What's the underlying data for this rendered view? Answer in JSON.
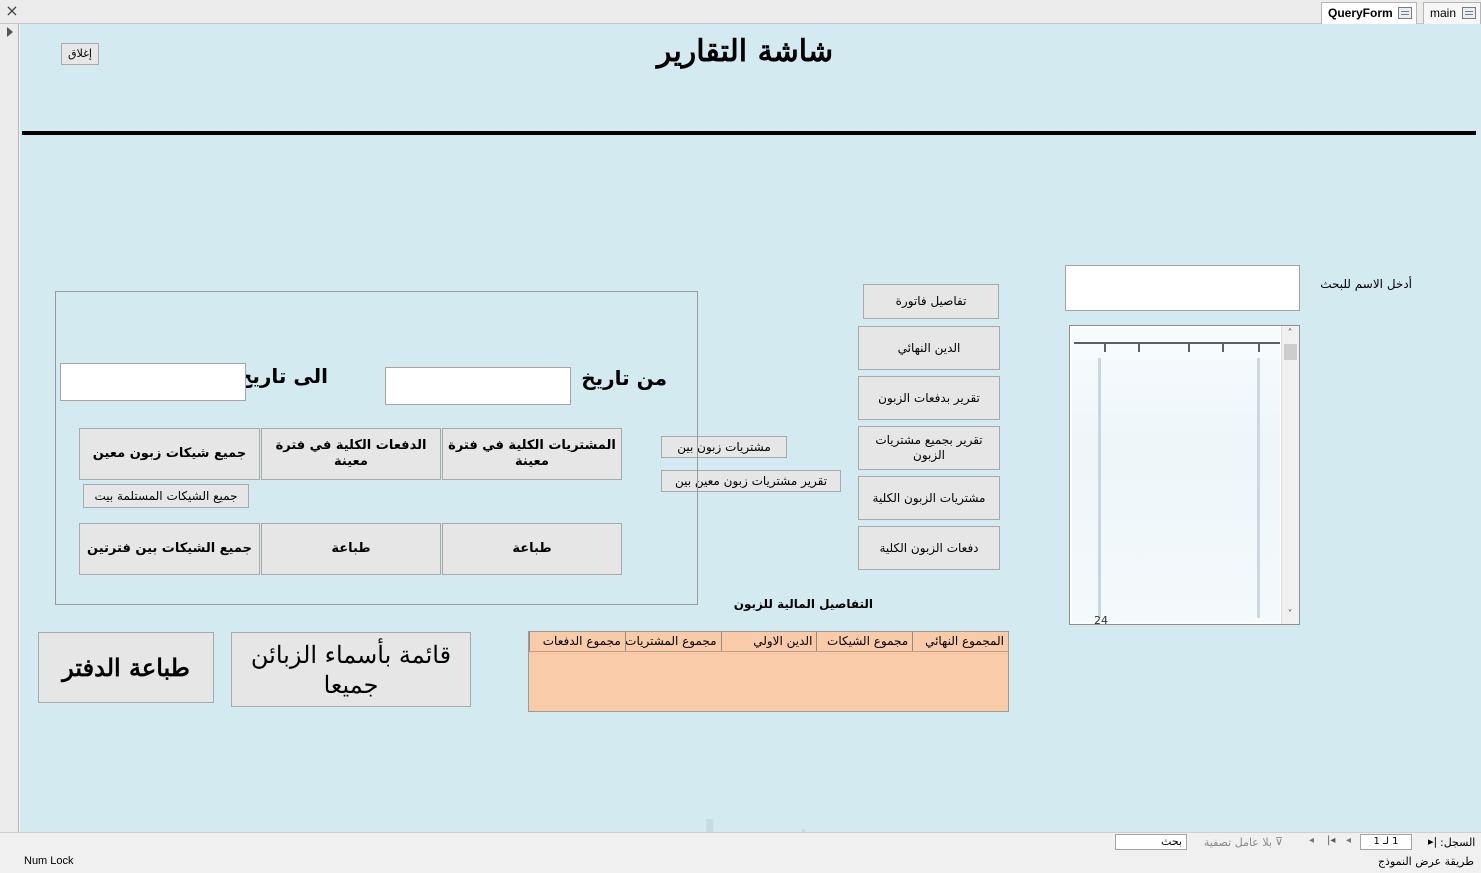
{
  "tabs": [
    {
      "label": "QueryForm",
      "active": true
    },
    {
      "label": "main",
      "active": false
    }
  ],
  "header": {
    "title": "شاشة التقارير",
    "close_label": "إغلاق"
  },
  "search": {
    "label": "أدخل الاسم للبحث",
    "value": "",
    "list_partial_text": "24"
  },
  "dates": {
    "from_label": "من تاريخ",
    "to_label": "الى تاريخ",
    "from_value": "",
    "to_value": ""
  },
  "period_buttons": {
    "total_purchases": "المشتريات الكلية في فترة معينة",
    "total_payments": "الدفعات الكلية في فترة معينة",
    "customer_cheques": "جميع شيكات زبون معين",
    "received_cheques": "جميع الشيكات المستلمة بيت",
    "print1": "طباعة",
    "print2": "طباعة",
    "cheques_between": "جميع الشيكات بين فترتين"
  },
  "middle_buttons": {
    "customer_purchases_between": "مشتريات زبون بين",
    "report_customer_purchases_between": "تقرير مشتريات زبون معين بين"
  },
  "report_buttons": [
    "تفاصيل فاتورة",
    "الدين النهائي",
    "تقرير بدفعات الزبون",
    "تقرير بجميع مشتريات الزبون",
    "مشتريات الزبون الكلية",
    "دفعات الزبون الكلية"
  ],
  "bottom_buttons": {
    "print_ledger": "طباعة الدفتر",
    "all_customers": "قائمة بأسماء الزبائن جميعا"
  },
  "summary": {
    "title": "التفاصيل المالية للزبون",
    "columns": [
      "المجموع النهائي",
      "مجموع الشيكات",
      "الدين الاولي",
      "مجموع المشتريات",
      "مجموع الدفعات"
    ]
  },
  "navigation": {
    "record_label": "السجل:",
    "record_value": "1 لـ 1",
    "filter_label": "بلا عامل تصفية",
    "search_label": "بحث"
  },
  "status": {
    "view_label": "طريقة عرض النموذج",
    "num_lock": "Num Lock"
  },
  "watermark": "خمسات"
}
